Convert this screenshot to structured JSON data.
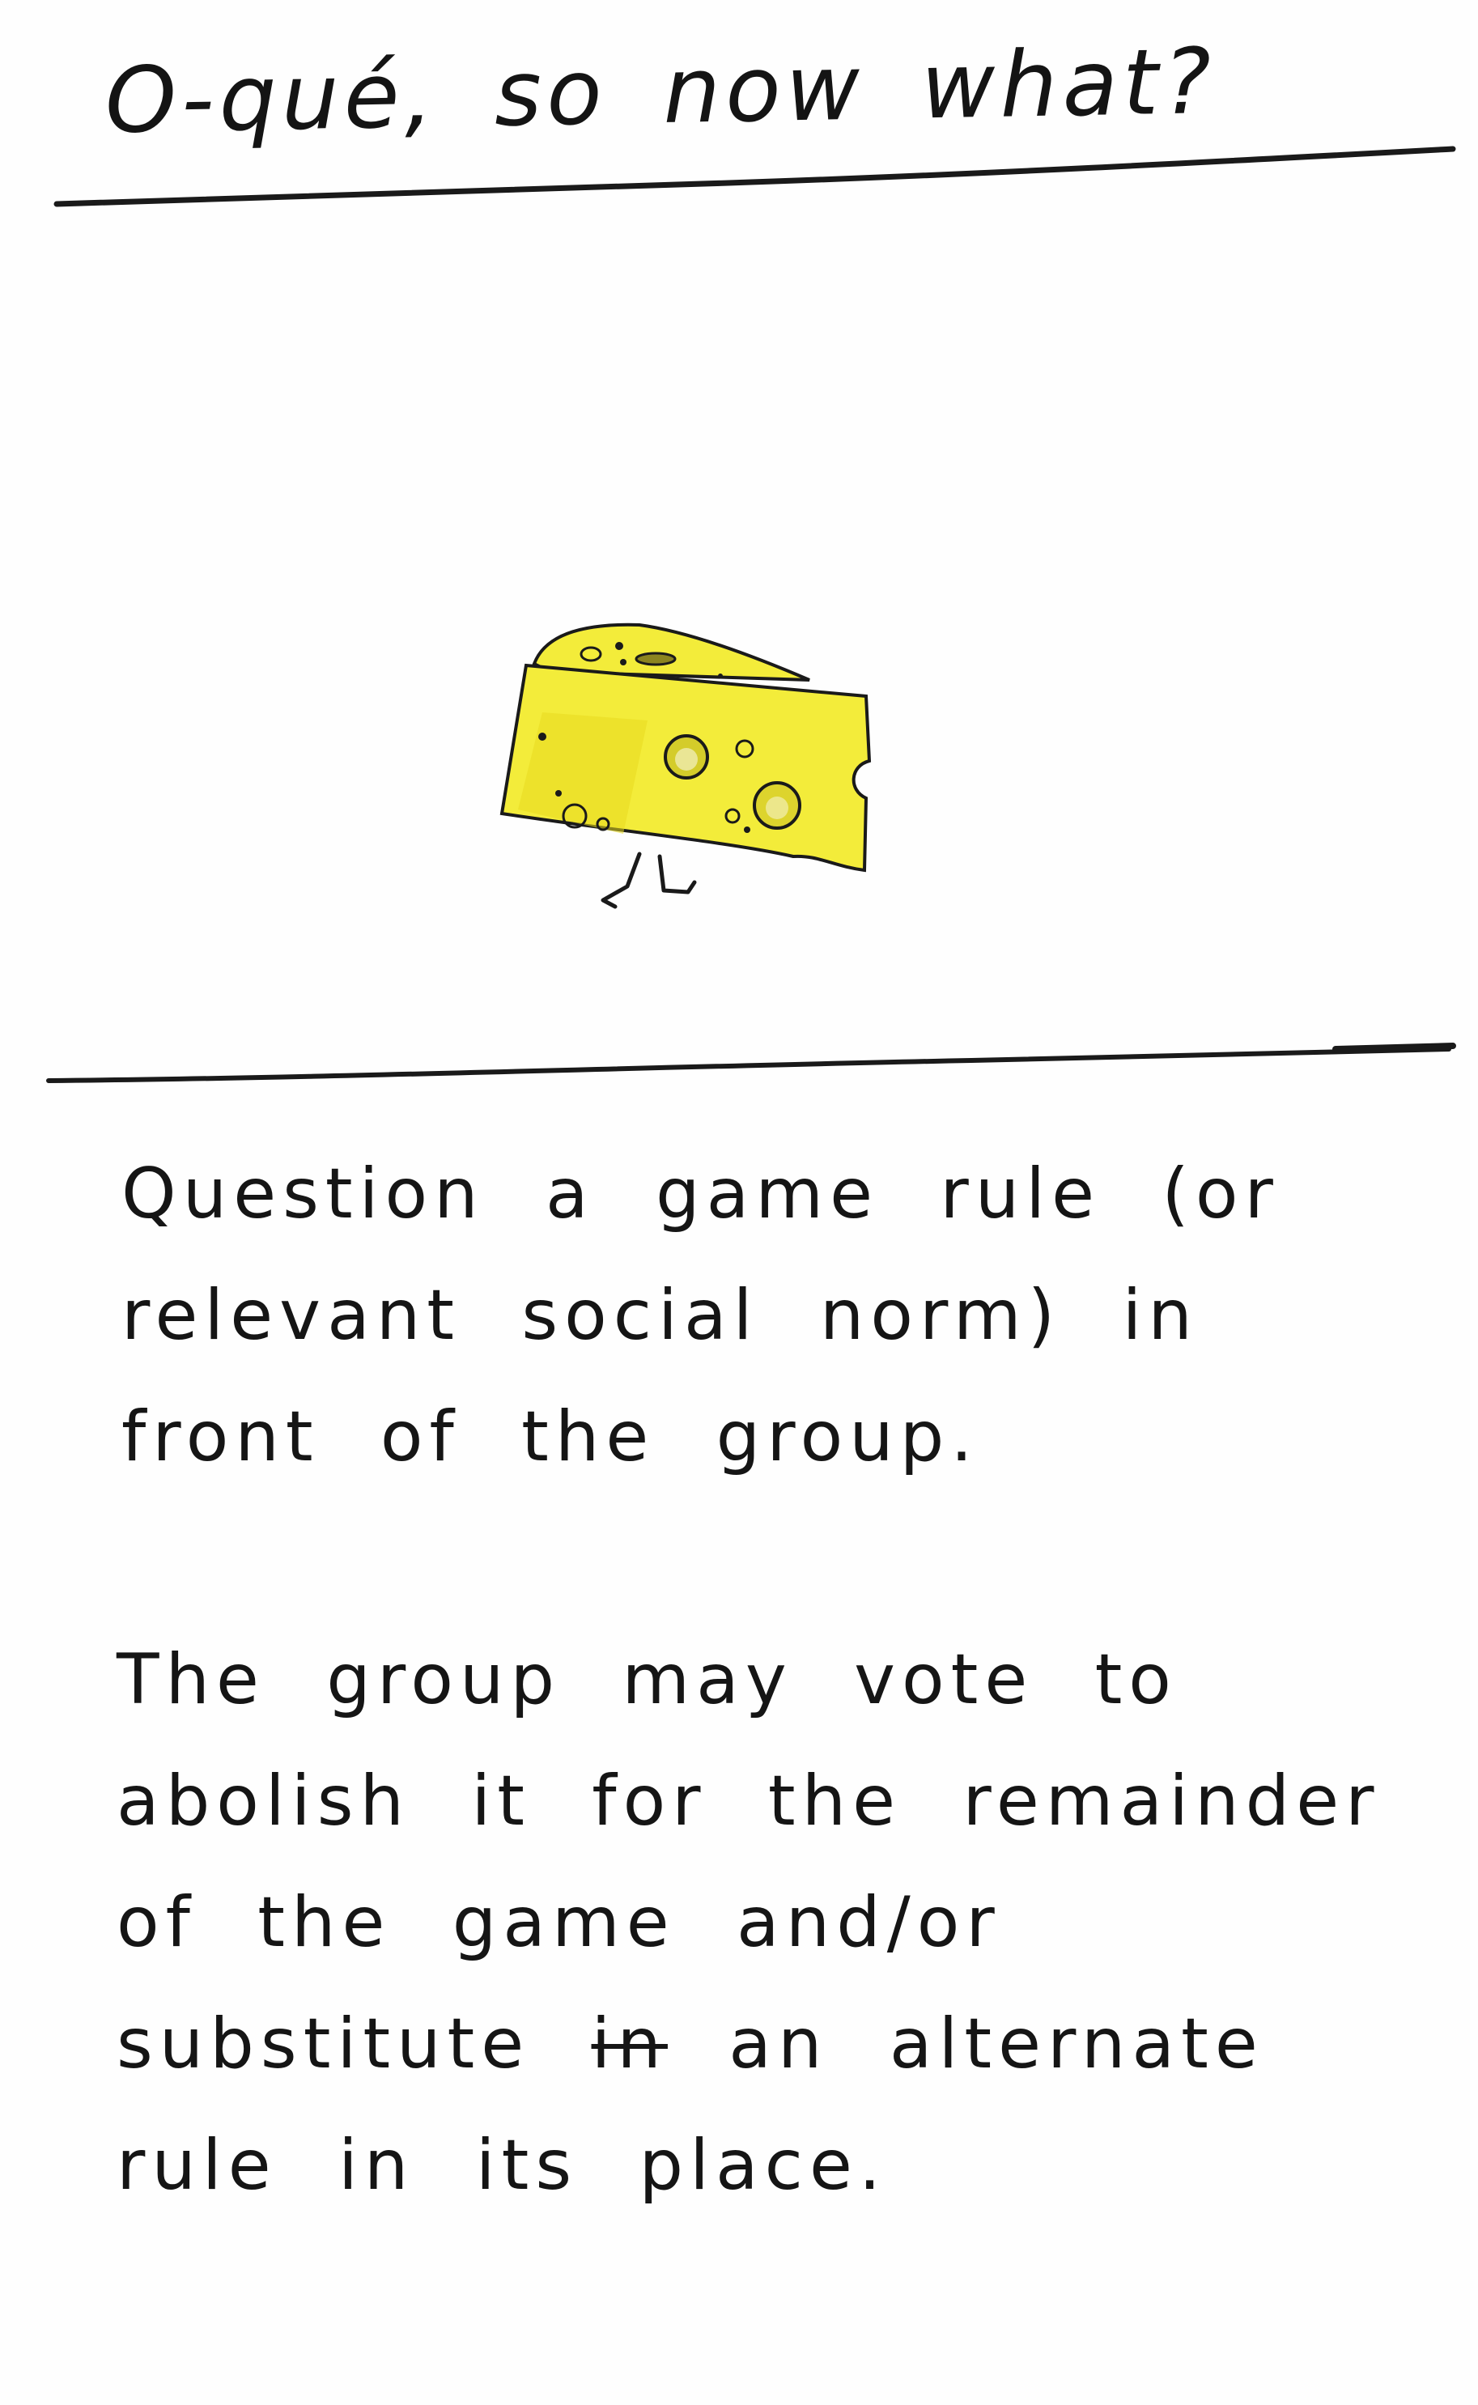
{
  "card": {
    "title": "O-qué, so now what?",
    "illustration": {
      "name": "walking-cheese",
      "colors": {
        "cheese_fill": "#f3ec3a",
        "cheese_shade": "#e7db1f",
        "outline": "#1a1a1a"
      }
    },
    "rule": {
      "paragraph_1": "Question a game rule (or relevant social norm) in front of the group.",
      "paragraph_2_start": "The group may vote to abolish it for the remainder of the game and/or substitute",
      "paragraph_2_struck": "in",
      "paragraph_2_end": "an alternate rule in its place."
    }
  }
}
